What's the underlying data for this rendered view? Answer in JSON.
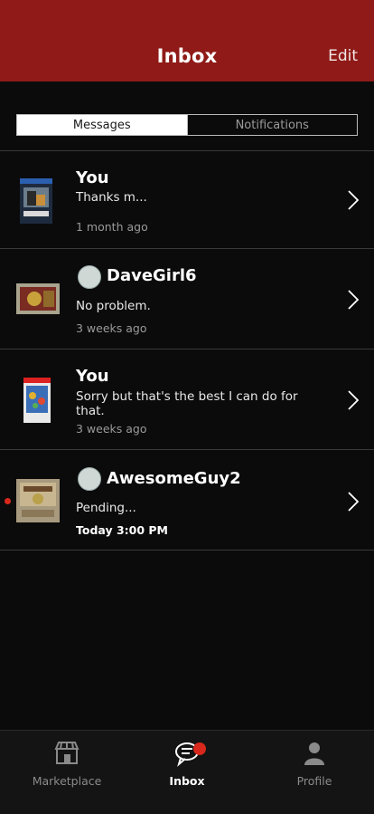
{
  "header": {
    "title": "Inbox",
    "edit_label": "Edit",
    "color": "#8f1a17"
  },
  "segments": [
    {
      "label": "Messages",
      "active": true
    },
    {
      "label": "Notifications",
      "active": false
    }
  ],
  "conversations": [
    {
      "sender": "You",
      "message": "Thanks m...",
      "time": "1 month ago",
      "unread": false,
      "avatar": false,
      "thumb": "game-cover-1"
    },
    {
      "sender": "DaveGirl6",
      "message": "No problem.",
      "time": "3 weeks ago",
      "unread": false,
      "avatar": true,
      "thumb": "zelda-ocarina-cart"
    },
    {
      "sender": "You",
      "message": "Sorry but that's the best I can do for that.",
      "time": "3 weeks ago",
      "unread": false,
      "avatar": false,
      "thumb": "smash-bros-cover"
    },
    {
      "sender": "AwesomeGuy2",
      "message": "Pending...",
      "time": "Today 3:00 PM",
      "unread": true,
      "avatar": true,
      "thumb": "zelda-nes-cart"
    }
  ],
  "tabs": [
    {
      "label": "Marketplace",
      "icon": "storefront-icon",
      "active": false
    },
    {
      "label": "Inbox",
      "icon": "chat-icon",
      "active": true,
      "badge": true
    },
    {
      "label": "Profile",
      "icon": "person-icon",
      "active": false
    }
  ],
  "colors": {
    "accent": "#d8281c",
    "background": "#0b0b0b"
  }
}
